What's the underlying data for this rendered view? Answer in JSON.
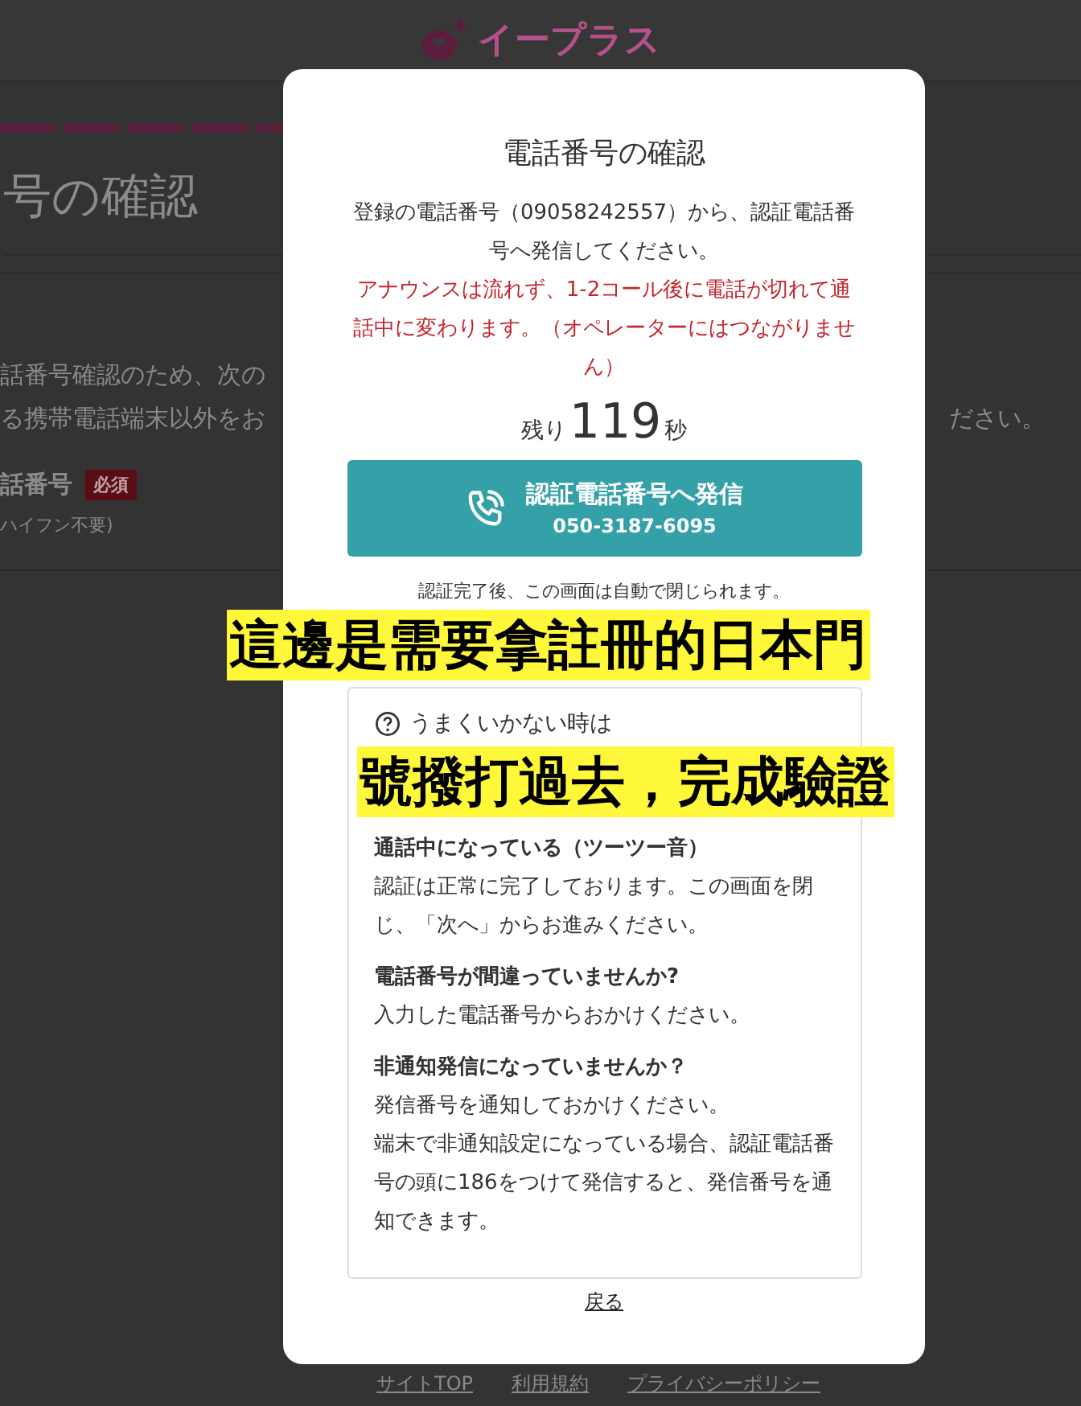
{
  "header": {
    "logo_text": "イープラス"
  },
  "page": {
    "heading": "号の確認",
    "intro_lines": [
      "話番号確認のため、次の",
      "る携帯電話端末以外をお"
    ],
    "intro_tail": "ださい。",
    "field": {
      "label": "話番号",
      "required_badge": "必須",
      "hint": "ハイフン不要)"
    }
  },
  "footer": {
    "links": [
      "サイトTOP",
      "利用規約",
      "プライバシーポリシー"
    ]
  },
  "modal": {
    "title": "電話番号の確認",
    "instruction": "登録の電話番号（09058242557）から、認証電話番号へ発信してください。",
    "warning": "アナウンスは流れず、1-2コール後に電話が切れて通話中に変わります。（オペレーターにはつながりません）",
    "countdown": {
      "prefix": "残り",
      "value": "119",
      "suffix": "秒"
    },
    "call_button": {
      "label": "認証電話番号へ発信",
      "number": "050-3187-6095"
    },
    "auto_close_note": "認証完了後、この画面は自動で閉じられます。",
    "help": {
      "title": "うまくいかない時は",
      "sections": [
        {
          "heading": "通話中になっている（ツーツー音）",
          "lines": [
            "認証は正常に完了しております。この画面を閉じ、「次へ」からお進みください。"
          ]
        },
        {
          "heading": "電話番号が間違っていませんか?",
          "lines": [
            "入力した電話番号からおかけください。"
          ]
        },
        {
          "heading": "非通知発信になっていませんか？",
          "lines": [
            "発信番号を通知しておかけください。",
            "端末で非通知設定になっている場合、認証電話番号の頭に186をつけて発信すると、発信番号を通知できます。"
          ]
        }
      ]
    },
    "back_link": "戻る"
  },
  "caption": {
    "lines": [
      "這邊是需要拿註冊的日本門",
      "號撥打過去，完成驗證"
    ]
  }
}
